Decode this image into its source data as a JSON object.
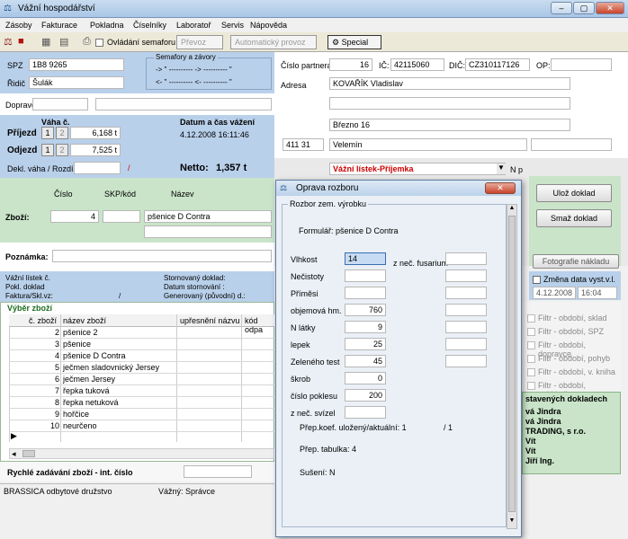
{
  "window": {
    "title": "Vážní hospodářství",
    "controls": [
      "–",
      "▢",
      "✕"
    ]
  },
  "menu": [
    "Zásoby",
    "Fakturace",
    "Pokladna",
    "Číselníky",
    "Laboratoř",
    "Servis",
    "Nápověda"
  ],
  "toolbar": {
    "semafor_label": "Ovládání semaforu",
    "prevoz_label": "Převoz",
    "auto_provoz_label": "Automatický provoz",
    "special_label": "Special"
  },
  "vehicle": {
    "spz_label": "SPZ",
    "spz_value": "1B8 9265",
    "ridic_label": "Řidič",
    "ridic_value": "Šulák",
    "semafory_title": "Semafory a závory",
    "sem_row1": "-> \" ----------      -> ---------- \"",
    "sem_row2": "<- \" ----------      <- ---------- \"",
    "dopravce_label": "Dopravce:"
  },
  "weights": {
    "vaha_label": "Váha č.",
    "datum_label": "Datum a čas vážení",
    "prijezd_label": "Příjezd",
    "prijezd_value": "6,168 t",
    "prijezd_datetime": "4.12.2008 16:11:46",
    "odjezd_label": "Odjezd",
    "odjezd_value": "7,525 t",
    "dekl_label": "Dekl. váha / Rozdíl",
    "slash": "/",
    "netto_label": "Netto:",
    "netto_value": "1,357 t",
    "scale1": "1",
    "scale2": "2"
  },
  "goods": {
    "cislo_label": "Číslo",
    "skp_label": "SKP/kód",
    "nazev_label": "Název",
    "zbozi_label": "Zboží:",
    "zbozi_cislo": "4",
    "zbozi_nazev": "pšenice D Contra",
    "poznamka_label": "Poznámka:"
  },
  "doc_info": {
    "vazni_listek": "Vážní lístek č.",
    "pokl_doklad": "Pokl. doklad",
    "faktura": "Faktura/Skl.vz:",
    "slash": "/",
    "storno": "Stornovaný doklad:",
    "datum_storna": "Datum stornování :",
    "generovany": "Generovaný (původní) d.:"
  },
  "vyber": {
    "title": "Výběr zboží",
    "headers": [
      "č. zboží",
      "název zboží",
      "upřesnění názvu",
      "kód odpa"
    ],
    "rows": [
      {
        "num": "2",
        "name": "pšenice 2"
      },
      {
        "num": "3",
        "name": "pšenice"
      },
      {
        "num": "4",
        "name": "pšenice D Contra"
      },
      {
        "num": "5",
        "name": "ječmen sladovnický Jersey"
      },
      {
        "num": "6",
        "name": "ječmen Jersey"
      },
      {
        "num": "7",
        "name": "řepka tuková"
      },
      {
        "num": "8",
        "name": "řepka netuková"
      },
      {
        "num": "9",
        "name": "hořčice"
      },
      {
        "num": "10",
        "name": "neurčeno"
      }
    ],
    "rychle_label": "Rychlé zadávání zboží - int. číslo"
  },
  "status": {
    "company": "BRASSICA odbytové družstvo",
    "user": "Vážný: Správce"
  },
  "partner": {
    "cislo_label": "Číslo partnera",
    "cislo_value": "16",
    "ic_label": "IČ:",
    "ic_value": "42115060",
    "dic_label": "DIČ:",
    "dic_value": "CZ310117126",
    "op_label": "OP:",
    "adresa_label": "Adresa",
    "adresa_name": "KOVAŘÍK Vladislav",
    "street": "Březno 16",
    "psc": "411 31",
    "city": "Velemín"
  },
  "doc_type": {
    "value": "Vážní lístek-Příjemka",
    "np": "N p",
    "arrow": "▼"
  },
  "right_buttons": {
    "uloz": "Ulož doklad",
    "smaz": "Smaž doklad",
    "foto": "Fotografie nákladu",
    "zmena": "Změna data vyst.v.l.",
    "zmena_date": "4.12.2008",
    "zmena_time": "16:04"
  },
  "filters": [
    "Filtr - období, sklad",
    "Filtr - období, SPZ",
    "Filtr - období, dopravce",
    "Filtr - období, pohyb",
    "Filtr - období, v. kniha",
    "Filtr - období, pokl.kniha"
  ],
  "recent": {
    "title": "stavených dokladech",
    "items": [
      "vá Jindra",
      "vá Jindra",
      "TRADING, s r.o.",
      "Vít",
      "Vít",
      "Jiří Ing."
    ]
  },
  "dialog": {
    "title": "Oprava rozboru",
    "group_title": "Rozbor zem. výrobku",
    "formular": "Formulář: pšenice D Contra",
    "left_fields": [
      {
        "label": "Vlhkost",
        "value": "14"
      },
      {
        "label": "Nečistoty",
        "value": ""
      },
      {
        "label": "Příměsi",
        "value": ""
      },
      {
        "label": "objemová hm.",
        "value": "760"
      },
      {
        "label": "N látky",
        "value": "9"
      },
      {
        "label": "lepek",
        "value": "25"
      },
      {
        "label": "Zeleného test",
        "value": "45"
      },
      {
        "label": "škrob",
        "value": "0"
      },
      {
        "label": "číslo poklesu",
        "value": "200"
      },
      {
        "label": "z neč. svízel",
        "value": ""
      }
    ],
    "fusarium_label": "z neč. fusarium",
    "koef": "Přep.koef. uložený/aktuální: 1",
    "koef_right": "/ 1",
    "tabulka": "Přep. tabulka: 4",
    "suseni": "Sušení: N"
  }
}
